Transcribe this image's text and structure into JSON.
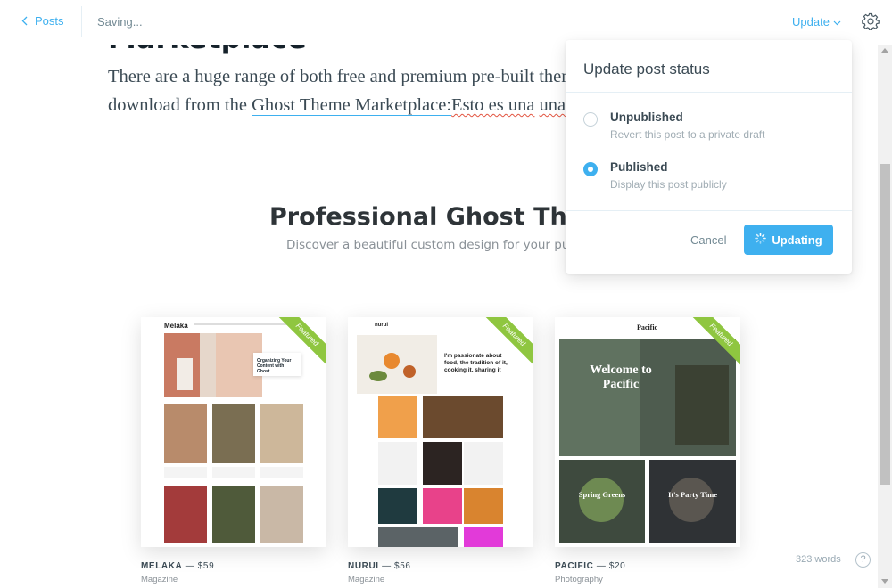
{
  "topbar": {
    "back_label": "Posts",
    "status": "Saving...",
    "update_label": "Update"
  },
  "editor": {
    "cut_heading": "Marketplace",
    "paragraph_part1": "There are a huge range of both free and premium pre-built themes which you can download from the ",
    "link_text": "Ghost Theme Marketplace:",
    "spell_text1": "Esto es una",
    "spell_text2": "una modificacion"
  },
  "marketplace_image": {
    "title": "Professional Ghost Themes",
    "subtitle": "Discover a beautiful custom design for your publication",
    "ribbon": "Featured",
    "themes": [
      {
        "name": "MELAKA",
        "price": "— $59",
        "category": "Magazine",
        "logo": "Melaka",
        "accent": "#d9a08e"
      },
      {
        "name": "NURUI",
        "price": "— $56",
        "category": "Magazine",
        "logo": "nurui",
        "accent": "#f5a64a"
      },
      {
        "name": "PACIFIC",
        "price": "— $20",
        "category": "Photography",
        "logo": "Pacific",
        "accent": "#5a6b5c"
      }
    ],
    "nurui_headline": "I'm passionate about food, the tradition of it, cooking it, sharing it",
    "pacific_headline": "Welcome to Pacific",
    "pacific_tile1": "Spring Greens",
    "pacific_tile2": "It's Party Time",
    "melaka_card_title": "Organizing Your Content with Ghost"
  },
  "status_dropdown": {
    "title": "Update post status",
    "options": [
      {
        "label": "Unpublished",
        "description": "Revert this post to a private draft",
        "checked": false
      },
      {
        "label": "Published",
        "description": "Display this post publicly",
        "checked": true
      }
    ],
    "cancel_label": "Cancel",
    "update_button_label": "Updating"
  },
  "footer": {
    "word_count": "323 words",
    "help": "?"
  },
  "colors": {
    "accent": "#3eb0ef",
    "ribbon": "#8fc640"
  }
}
